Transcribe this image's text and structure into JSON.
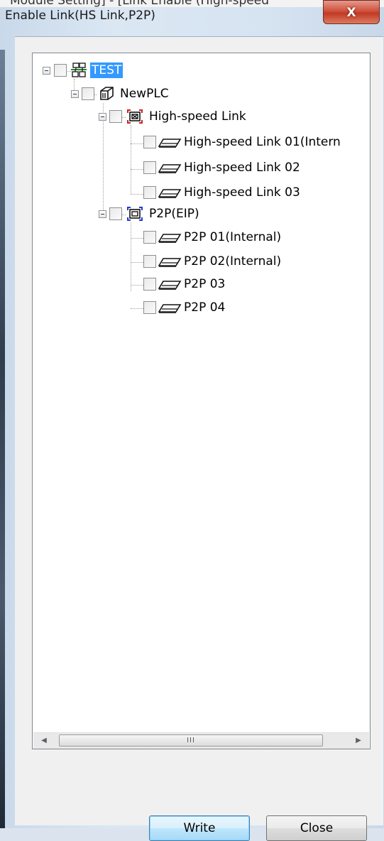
{
  "background_page": {
    "cut_off_text": "Module Setting] - [Link Enable (High-speed"
  },
  "window": {
    "title": "Enable Link(HS Link,P2P)",
    "close_glyph": "X"
  },
  "tree": {
    "root": {
      "label": "TEST",
      "icon": "network-project-icon",
      "selected": true,
      "checked": false
    },
    "plc": {
      "label": "NewPLC",
      "icon": "plc-cube-icon",
      "checked": false
    },
    "hs_group": {
      "label": "High-speed Link",
      "icon": "high-speed-link-group-icon",
      "checked": false,
      "children": [
        {
          "label": "High-speed Link 01(Intern",
          "icon": "link-block-icon",
          "checked": false
        },
        {
          "label": "High-speed Link 02",
          "icon": "link-block-icon",
          "checked": false
        },
        {
          "label": "High-speed Link 03",
          "icon": "link-block-icon",
          "checked": false
        }
      ]
    },
    "p2p_group": {
      "label": "P2P(EIP)",
      "icon": "p2p-group-icon",
      "checked": false,
      "children": [
        {
          "label": "P2P 01(Internal)",
          "icon": "link-block-icon",
          "checked": false
        },
        {
          "label": "P2P 02(Internal)",
          "icon": "link-block-icon",
          "checked": false
        },
        {
          "label": "P2P 03",
          "icon": "link-block-icon",
          "checked": false
        },
        {
          "label": "P2P 04",
          "icon": "link-block-icon",
          "checked": false
        }
      ]
    }
  },
  "scrollbar": {
    "left_arrow": "◀",
    "right_arrow": "▶",
    "grip": "III"
  },
  "buttons": {
    "write_label": "Write",
    "close_label": "Close"
  },
  "colors": {
    "selection": "#3399ff",
    "close_button": "#c13a26",
    "hs_icon_accent": "#d42020",
    "p2p_icon_accent": "#1f3fd0"
  }
}
